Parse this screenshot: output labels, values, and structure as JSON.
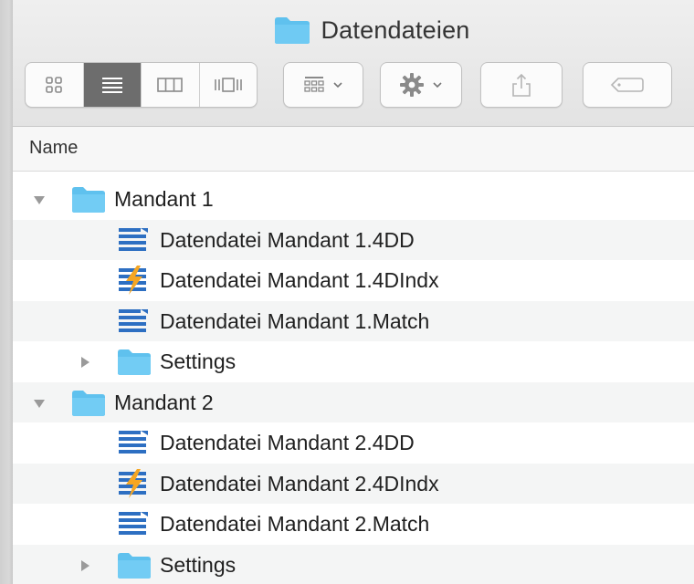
{
  "window": {
    "title": "Datendateien"
  },
  "toolbar": {
    "view_buttons": [
      {
        "name": "icon-view",
        "active": false
      },
      {
        "name": "list-view",
        "active": true
      },
      {
        "name": "column-view",
        "active": false
      },
      {
        "name": "cover-flow-view",
        "active": false
      }
    ],
    "icons": [
      "group-icon",
      "gear-icon",
      "share-icon",
      "tag-icon"
    ]
  },
  "list_header": {
    "name_label": "Name"
  },
  "rows": [
    {
      "label": "Mandant 1",
      "kind": "folder",
      "expanded": true,
      "level": 0
    },
    {
      "label": "Datendatei Mandant 1.4DD",
      "kind": "data-file",
      "level": 1
    },
    {
      "label": "Datendatei Mandant 1.4DIndx",
      "kind": "index-file",
      "level": 1
    },
    {
      "label": "Datendatei Mandant 1.Match",
      "kind": "data-file",
      "level": 1
    },
    {
      "label": "Settings",
      "kind": "folder",
      "expanded": false,
      "level": 1
    },
    {
      "label": "Mandant 2",
      "kind": "folder",
      "expanded": true,
      "level": 0
    },
    {
      "label": "Datendatei Mandant 2.4DD",
      "kind": "data-file",
      "level": 1
    },
    {
      "label": "Datendatei Mandant 2.4DIndx",
      "kind": "index-file",
      "level": 1
    },
    {
      "label": "Datendatei Mandant 2.Match",
      "kind": "data-file",
      "level": 1
    },
    {
      "label": "Settings",
      "kind": "folder",
      "expanded": false,
      "level": 1
    }
  ],
  "colors": {
    "folder": "#5fc1ee",
    "file_blue": "#2d6fc2",
    "lightning": "#f5a623",
    "active_segment": "#6d6d6d"
  }
}
